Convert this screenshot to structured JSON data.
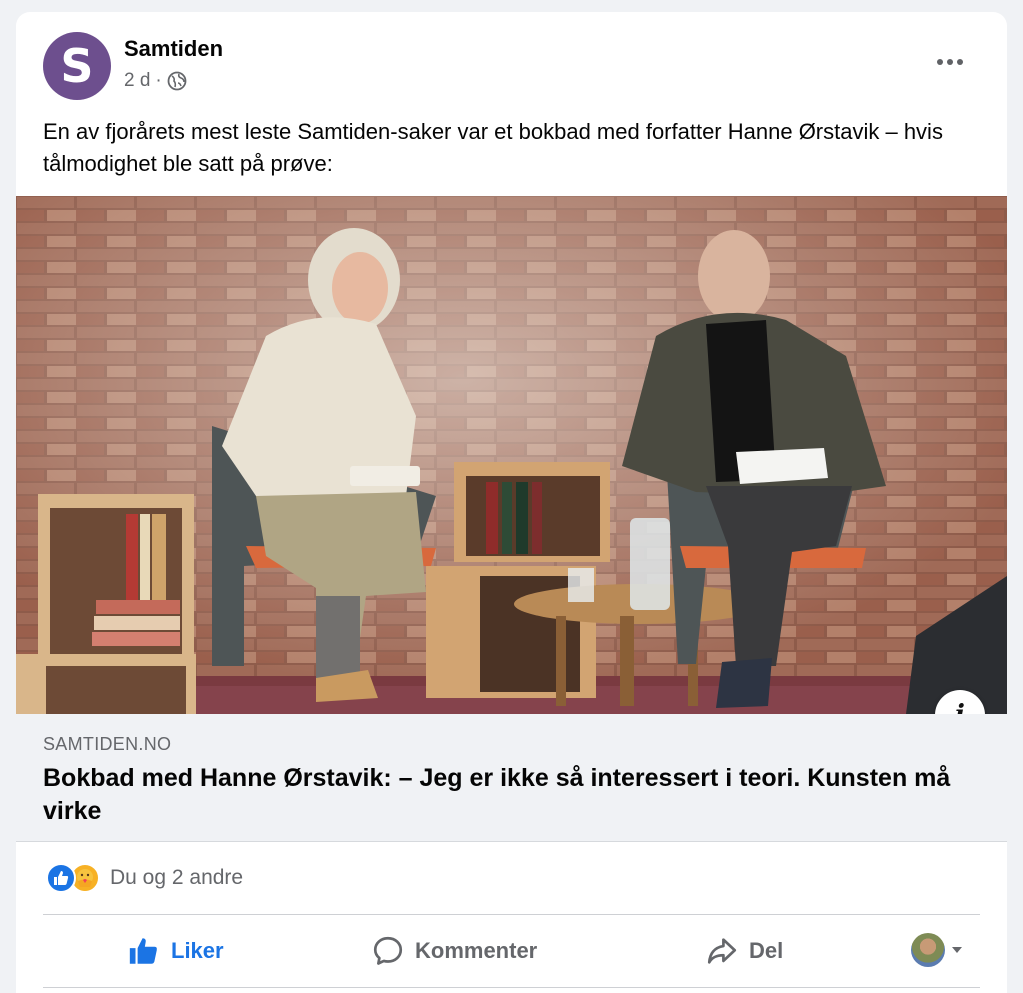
{
  "post": {
    "page_name": "Samtiden",
    "avatar_letter": "S",
    "time": "2 d",
    "separator": "·",
    "privacy_icon": "globe-icon",
    "text": "En av fjorårets mest leste Samtiden-saker var et bokbad med forfatter Hanne Ørstavik – hvis tålmodighet ble satt på prøve:"
  },
  "link": {
    "domain": "SAMTIDEN.NO",
    "title": "Bokbad med Hanne Ørstavik: – Jeg er ikke så interessert i teori. Kunsten må virke",
    "info_icon": "i"
  },
  "reactions": {
    "summary": "Du og 2 andre",
    "types": [
      "like",
      "care"
    ]
  },
  "actions": {
    "like_label": "Liker",
    "comment_label": "Kommenter",
    "share_label": "Del"
  },
  "colors": {
    "accent": "#1b74e4",
    "avatar_bg": "#6d4f8e",
    "secondary_text": "#65676b"
  }
}
